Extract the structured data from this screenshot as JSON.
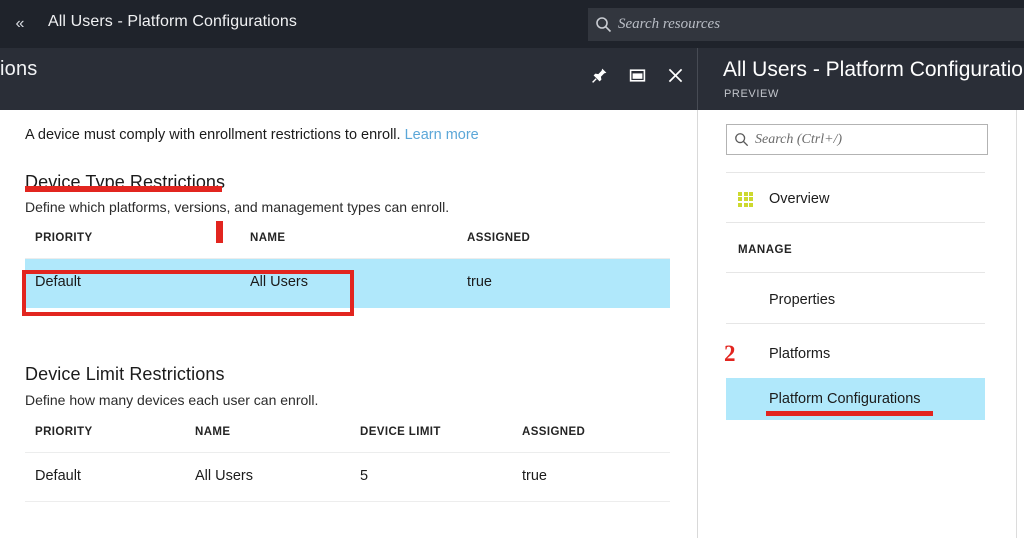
{
  "topbar": {
    "collapse_icon": "double-chevron-left-icon",
    "breadcrumb_title": "All Users - Platform Configurations",
    "search": {
      "icon": "search-icon",
      "placeholder": "Search resources",
      "value": ""
    }
  },
  "band": {
    "left_clipped_text": "ions",
    "actions": [
      {
        "name": "pin-icon",
        "label": "Pin"
      },
      {
        "name": "maximize-icon",
        "label": "Maximize"
      },
      {
        "name": "close-icon",
        "label": "Close"
      }
    ],
    "blade_title": "All Users - Platform Configurations",
    "blade_badge": "PREVIEW"
  },
  "content": {
    "lead_text": "A device must comply with enrollment restrictions to enroll.",
    "lead_link": "Learn more",
    "sections": [
      {
        "title": "Device Type Restrictions",
        "subtitle": "Define which platforms, versions, and management types can enroll.",
        "columns": [
          "PRIORITY",
          "NAME",
          "ASSIGNED"
        ],
        "rows": [
          {
            "priority": "Default",
            "name": "All Users",
            "assigned": "true",
            "selected": true
          }
        ]
      },
      {
        "title": "Device Limit Restrictions",
        "subtitle": "Define how many devices each user can enroll.",
        "columns": [
          "PRIORITY",
          "NAME",
          "DEVICE LIMIT",
          "ASSIGNED"
        ],
        "rows": [
          {
            "priority": "Default",
            "name": "All Users",
            "device_limit": "5",
            "assigned": "true",
            "selected": false
          }
        ]
      }
    ]
  },
  "right_panel": {
    "search": {
      "icon": "search-icon",
      "placeholder": "Search (Ctrl+/)",
      "value": ""
    },
    "items": [
      {
        "label": "Overview",
        "icon": "grid-icon",
        "type": "item",
        "selected": false
      },
      {
        "label": "MANAGE",
        "icon": "",
        "type": "group",
        "selected": false
      },
      {
        "label": "Properties",
        "icon": "",
        "type": "item",
        "selected": false
      },
      {
        "label": "Platforms",
        "icon": "",
        "type": "item",
        "selected": false
      },
      {
        "label": "Platform Configurations",
        "icon": "",
        "type": "item",
        "selected": true
      }
    ]
  },
  "annotations": {
    "marker_number": "2",
    "color": "#e2251f"
  },
  "colors": {
    "topbar_bg": "#1f232b",
    "band_bg": "#2a2e37",
    "selection_blue": "#b0e8fb",
    "link_blue": "#5ba7d8",
    "overview_icon_green": "#cdd92e",
    "annotation_red": "#e2251f"
  }
}
